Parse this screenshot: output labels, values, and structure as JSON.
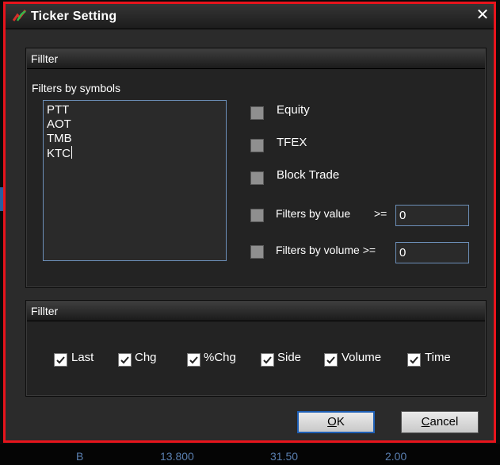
{
  "window": {
    "title": "Ticker Setting",
    "close_glyph": "✕"
  },
  "filter_group": {
    "title": "Fillter",
    "symbols_label": "Filters by symbols",
    "symbols": [
      "PTT",
      "AOT",
      "TMB",
      "KTC"
    ],
    "options": [
      {
        "label": "Equity",
        "checked": false
      },
      {
        "label": "TFEX",
        "checked": false
      },
      {
        "label": "Block Trade",
        "checked": false
      }
    ],
    "by_value": {
      "label": "Filters by value",
      "operator": ">=",
      "value": "0",
      "checked": false
    },
    "by_volume": {
      "label": "Filters by volume >=",
      "value": "0",
      "checked": false
    }
  },
  "columns_group": {
    "title": "Fillter",
    "columns": [
      {
        "label": "Last",
        "checked": true
      },
      {
        "label": "Chg",
        "checked": true
      },
      {
        "label": "%Chg",
        "checked": true
      },
      {
        "label": "Side",
        "checked": true
      },
      {
        "label": "Volume",
        "checked": true
      },
      {
        "label": "Time",
        "checked": true
      }
    ]
  },
  "buttons": {
    "ok_mnemonic": "O",
    "ok_rest": "K",
    "cancel_mnemonic": "C",
    "cancel_rest": "ancel"
  },
  "background_row": [
    "B",
    "13.800",
    "31.50",
    "2.00"
  ],
  "colors": {
    "accent_border": "#e8141c",
    "input_border": "#6c8fb8",
    "dialog_bg": "#2b2b2b"
  }
}
